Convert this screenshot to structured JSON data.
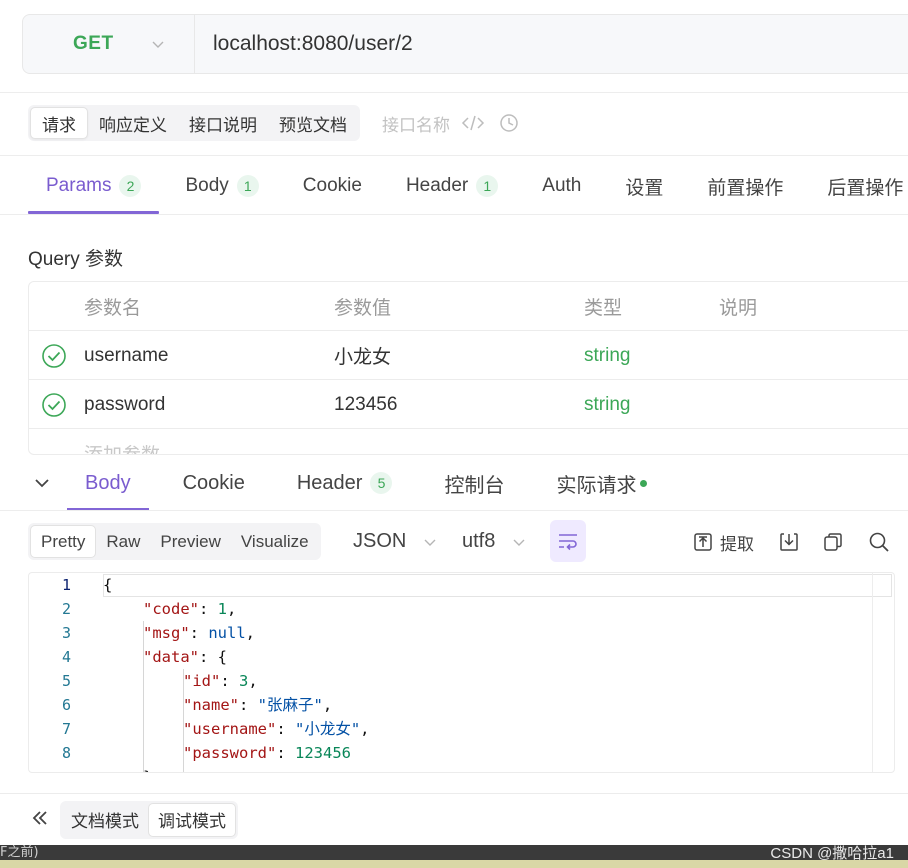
{
  "request": {
    "method": "GET",
    "url": "localhost:8080/user/2"
  },
  "doc_tabs": {
    "items": [
      "请求",
      "响应定义",
      "接口说明",
      "预览文档"
    ],
    "active": 0,
    "name_placeholder": "接口名称"
  },
  "param_tabs": [
    {
      "label": "Params",
      "badge": "2"
    },
    {
      "label": "Body",
      "badge": "1"
    },
    {
      "label": "Cookie",
      "badge": ""
    },
    {
      "label": "Header",
      "badge": "1"
    },
    {
      "label": "Auth",
      "badge": ""
    },
    {
      "label": "设置",
      "badge": ""
    },
    {
      "label": "前置操作",
      "badge": ""
    },
    {
      "label": "后置操作",
      "badge": ""
    }
  ],
  "query": {
    "title": "Query 参数",
    "headers": [
      "参数名",
      "参数值",
      "类型",
      "说明"
    ],
    "rows": [
      {
        "name": "username",
        "value": "小龙女",
        "type": "string",
        "desc": ""
      },
      {
        "name": "password",
        "value": "123456",
        "type": "string",
        "desc": ""
      }
    ],
    "add_placeholder": "添加参数"
  },
  "response_tabs": [
    {
      "label": "Body",
      "badge": ""
    },
    {
      "label": "Cookie",
      "badge": ""
    },
    {
      "label": "Header",
      "badge": "5"
    },
    {
      "label": "控制台",
      "badge": ""
    },
    {
      "label": "实际请求",
      "badge": ""
    }
  ],
  "format": {
    "modes": [
      "Pretty",
      "Raw",
      "Preview",
      "Visualize"
    ],
    "active": 0,
    "type_select": "JSON",
    "encoding_select": "utf8",
    "extract_label": "提取"
  },
  "code": {
    "line_numbers": [
      "1",
      "2",
      "3",
      "4",
      "5",
      "6",
      "7",
      "8"
    ],
    "lines": [
      {
        "indent": 0,
        "tokens": [
          [
            "p",
            "{"
          ]
        ]
      },
      {
        "indent": 1,
        "tokens": [
          [
            "k",
            "\"code\""
          ],
          [
            "p",
            ": "
          ],
          [
            "n",
            "1"
          ],
          [
            "p",
            ","
          ]
        ]
      },
      {
        "indent": 1,
        "tokens": [
          [
            "k",
            "\"msg\""
          ],
          [
            "p",
            ": "
          ],
          [
            "kw",
            "null"
          ],
          [
            "p",
            ","
          ]
        ]
      },
      {
        "indent": 1,
        "tokens": [
          [
            "k",
            "\"data\""
          ],
          [
            "p",
            ": {"
          ]
        ]
      },
      {
        "indent": 2,
        "tokens": [
          [
            "k",
            "\"id\""
          ],
          [
            "p",
            ": "
          ],
          [
            "n",
            "3"
          ],
          [
            "p",
            ","
          ]
        ]
      },
      {
        "indent": 2,
        "tokens": [
          [
            "k",
            "\"name\""
          ],
          [
            "p",
            ": "
          ],
          [
            "s",
            "\"张麻子\""
          ],
          [
            "p",
            ","
          ]
        ]
      },
      {
        "indent": 2,
        "tokens": [
          [
            "k",
            "\"username\""
          ],
          [
            "p",
            ": "
          ],
          [
            "s",
            "\"小龙女\""
          ],
          [
            "p",
            ","
          ]
        ]
      },
      {
        "indent": 2,
        "tokens": [
          [
            "k",
            "\"password\""
          ],
          [
            "p",
            ": "
          ],
          [
            "n",
            "123456"
          ]
        ]
      },
      {
        "indent": 1,
        "tokens": [
          [
            "p",
            "}"
          ]
        ]
      }
    ]
  },
  "bottom": {
    "modes": [
      "文档模式",
      "调试模式"
    ],
    "active": 1
  },
  "taskbar": {
    "left_text": "F之前)",
    "watermark": "CSDN @撒哈拉a1"
  },
  "colors": {
    "accent": "#8266d6",
    "method_green": "#3ca757",
    "json_key": "#a31515",
    "json_number": "#098658",
    "json_string": "#0451a5"
  }
}
